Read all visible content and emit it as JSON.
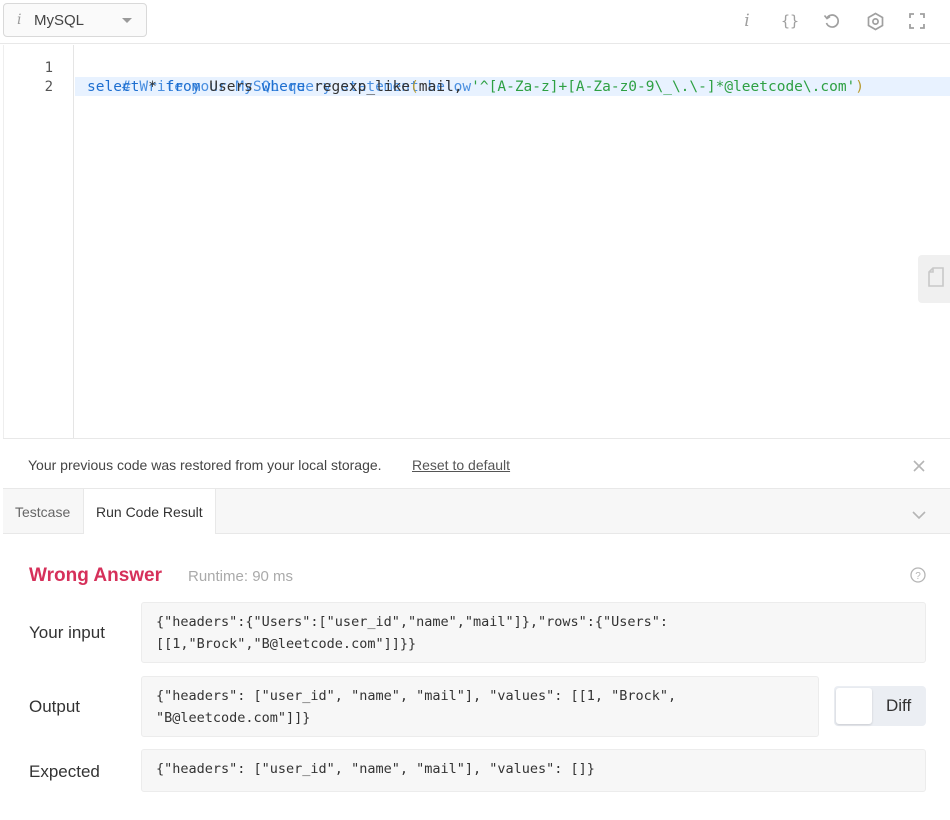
{
  "toolbar": {
    "language": "MySQL",
    "icons": [
      "info-icon",
      "format-braces-icon",
      "reset-undo-icon",
      "settings-gear-icon",
      "fullscreen-icon"
    ]
  },
  "editor": {
    "line_numbers": [
      "1",
      "2"
    ],
    "line1_comment": "# Write your MySQL query statement below",
    "line2": {
      "kw_select": "select",
      "star": " * ",
      "kw_from": "from",
      "table": " Users ",
      "kw_where": "where",
      "func": " regexp_like",
      "paren_open": "(",
      "arg": "mail, ",
      "pattern": "'^[A-Za-z]+[A-Za-z0-9\\_\\.\\-]*@leetcode\\.com'",
      "paren_close": ")"
    }
  },
  "notice": {
    "message": "Your previous code was restored from your local storage.",
    "reset_label": "Reset to default"
  },
  "tabs": [
    "Testcase",
    "Run Code Result"
  ],
  "result": {
    "status": "Wrong Answer",
    "runtime": "Runtime: 90 ms",
    "input_label": "Your input",
    "input_value": "{\"headers\":{\"Users\":[\"user_id\",\"name\",\"mail\"]},\"rows\":{\"Users\":\n[[1,\"Brock\",\"B@leetcode.com\"]]}}",
    "output_label": "Output",
    "output_value": "{\"headers\": [\"user_id\", \"name\", \"mail\"], \"values\": [[1, \"Brock\",\n\"B@leetcode.com\"]]}",
    "expected_label": "Expected",
    "expected_value": "{\"headers\": [\"user_id\", \"name\", \"mail\"], \"values\": []}",
    "diff_label": "Diff"
  },
  "colors": {
    "status_error": "#d6305a",
    "keyword": "#1e6fd0",
    "comment": "#4a8fe0",
    "string": "#2ea043"
  }
}
